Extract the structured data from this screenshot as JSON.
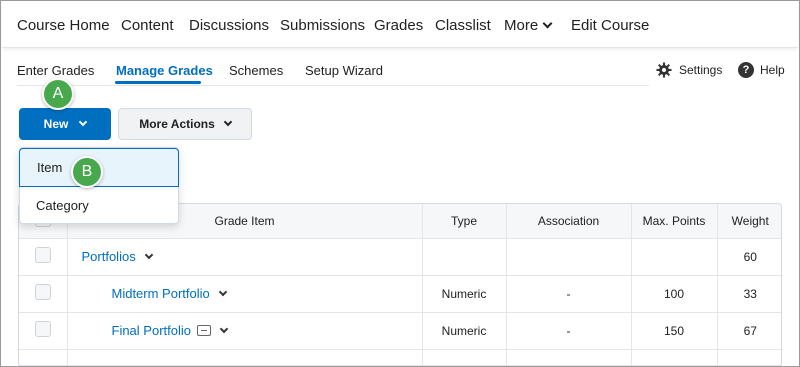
{
  "topnav": {
    "items": [
      "Course Home",
      "Content",
      "Discussions",
      "Submissions",
      "Grades",
      "Classlist",
      "More",
      "Edit Course"
    ]
  },
  "tabs": [
    "Enter Grades",
    "Manage Grades",
    "Schemes",
    "Setup Wizard"
  ],
  "active_tab": "Manage Grades",
  "toolbar": {
    "settings_label": "Settings",
    "help_label": "Help",
    "new_label": "New",
    "more_actions_label": "More Actions"
  },
  "dropdown": {
    "items": [
      "Item",
      "Category"
    ]
  },
  "callouts": {
    "a": "A",
    "b": "B"
  },
  "table": {
    "headers": [
      "Grade Item",
      "Type",
      "Association",
      "Max. Points",
      "Weight"
    ],
    "rows": [
      {
        "name": "Portfolios",
        "type": "",
        "association": "",
        "max_points": "",
        "weight": "60"
      },
      {
        "name": "Midterm Portfolio",
        "type": "Numeric",
        "association": "-",
        "max_points": "100",
        "weight": "33"
      },
      {
        "name": "Final Portfolio",
        "type": "Numeric",
        "association": "-",
        "max_points": "150",
        "weight": "67"
      }
    ]
  },
  "colors": {
    "accent": "#006fbf",
    "callout": "#47a84e"
  }
}
